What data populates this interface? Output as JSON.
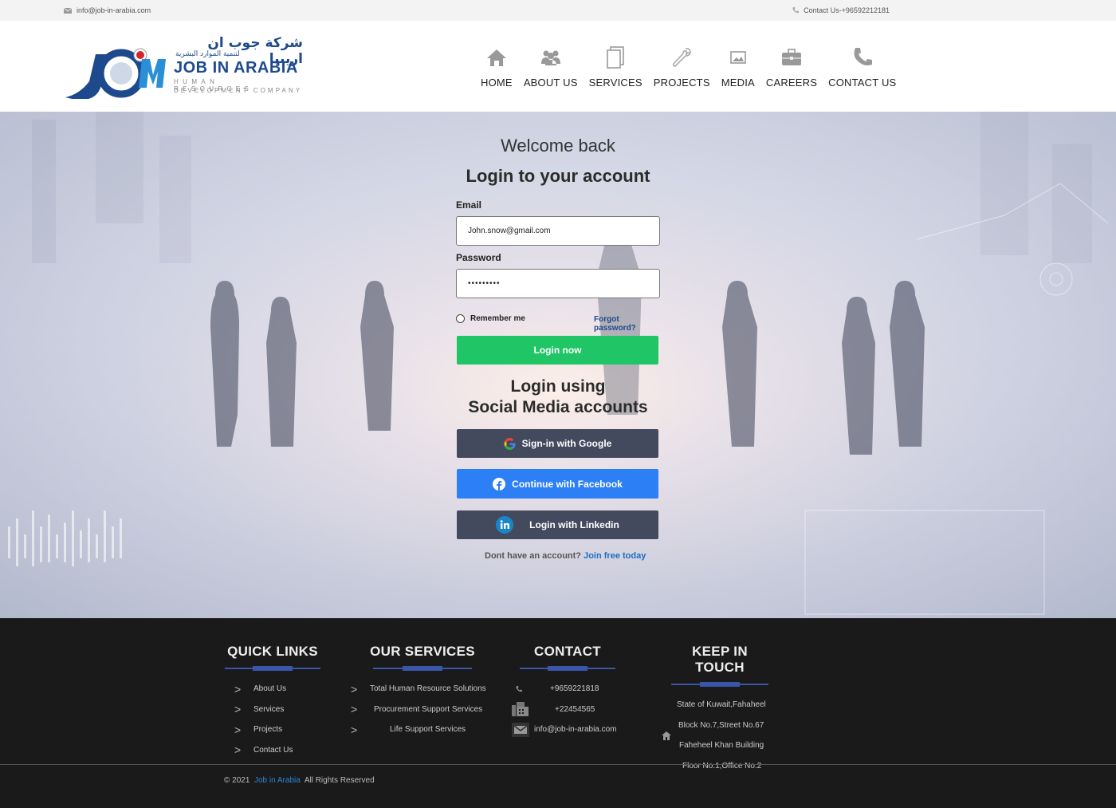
{
  "topbar": {
    "email": "info@job-in-arabia.com",
    "phone": "Contact Us-+96592212181"
  },
  "logo": {
    "arabic_line1": "شركة جوب ان اريبيا",
    "arabic_line2": "لتنمية الموارد البشرية",
    "brand": "JOB IN ARABIA",
    "sub1": "HUMAN RESOURCES",
    "sub2": "DEVELOPMENT COMPANY"
  },
  "nav": {
    "items": [
      {
        "label": "HOME",
        "icon": "home-icon"
      },
      {
        "label": "ABOUT US",
        "icon": "users-icon"
      },
      {
        "label": "SERVICES",
        "icon": "document-icon"
      },
      {
        "label": "PROJECTS",
        "icon": "wrench-icon"
      },
      {
        "label": "MEDIA",
        "icon": "image-icon"
      },
      {
        "label": "CAREERS",
        "icon": "briefcase-icon"
      },
      {
        "label": "CONTACT US",
        "icon": "phone-icon"
      }
    ]
  },
  "login": {
    "welcome": "Welcome back",
    "title": "Login to your account",
    "email_label": "Email",
    "email_value": "John.snow@gmail.com",
    "password_label": "Password",
    "password_value": "•••••••••",
    "remember": "Remember me",
    "forgot": "Forgot password?",
    "login_button": "Login now",
    "social_title_line1": "Login using",
    "social_title_line2": "Social Media accounts",
    "google_button": "Sign-in with Google",
    "facebook_button": "Continue with Facebook",
    "linkedin_button": "Login with Linkedin",
    "signup_text": "Dont have an account?",
    "signup_link": "Join free today"
  },
  "footer": {
    "quick_links": {
      "title": "QUICK LINKS",
      "items": [
        "About Us",
        "Services",
        "Projects",
        "Contact Us"
      ]
    },
    "services": {
      "title": "OUR SERVICES",
      "items": [
        "Total Human Resource Solutions",
        "Procurement Support Services",
        "Life Support Services"
      ]
    },
    "contact": {
      "title": "CONTACT",
      "phone": "+9659221818",
      "fax": "+22454565",
      "email": "info@job-in-arabia.com"
    },
    "keep_in_touch": {
      "title": "KEEP IN TOUCH",
      "lines": [
        "State of Kuwait,Fahaheel",
        "Block No.7,Street No.67",
        "Faheheel Khan Building",
        "Floor No.1,Office No.2"
      ]
    },
    "copyright": {
      "prefix": "© 2021",
      "brand": "Job in Arabia",
      "suffix": "All Rights Reserved"
    }
  },
  "colors": {
    "brand_blue": "#1d4a8c",
    "login_green": "#20c565",
    "facebook_blue": "#2d7ff5",
    "dark_button": "#434a5e",
    "footer_bg": "#1a1a1a",
    "footer_accent": "#3a56a8"
  }
}
